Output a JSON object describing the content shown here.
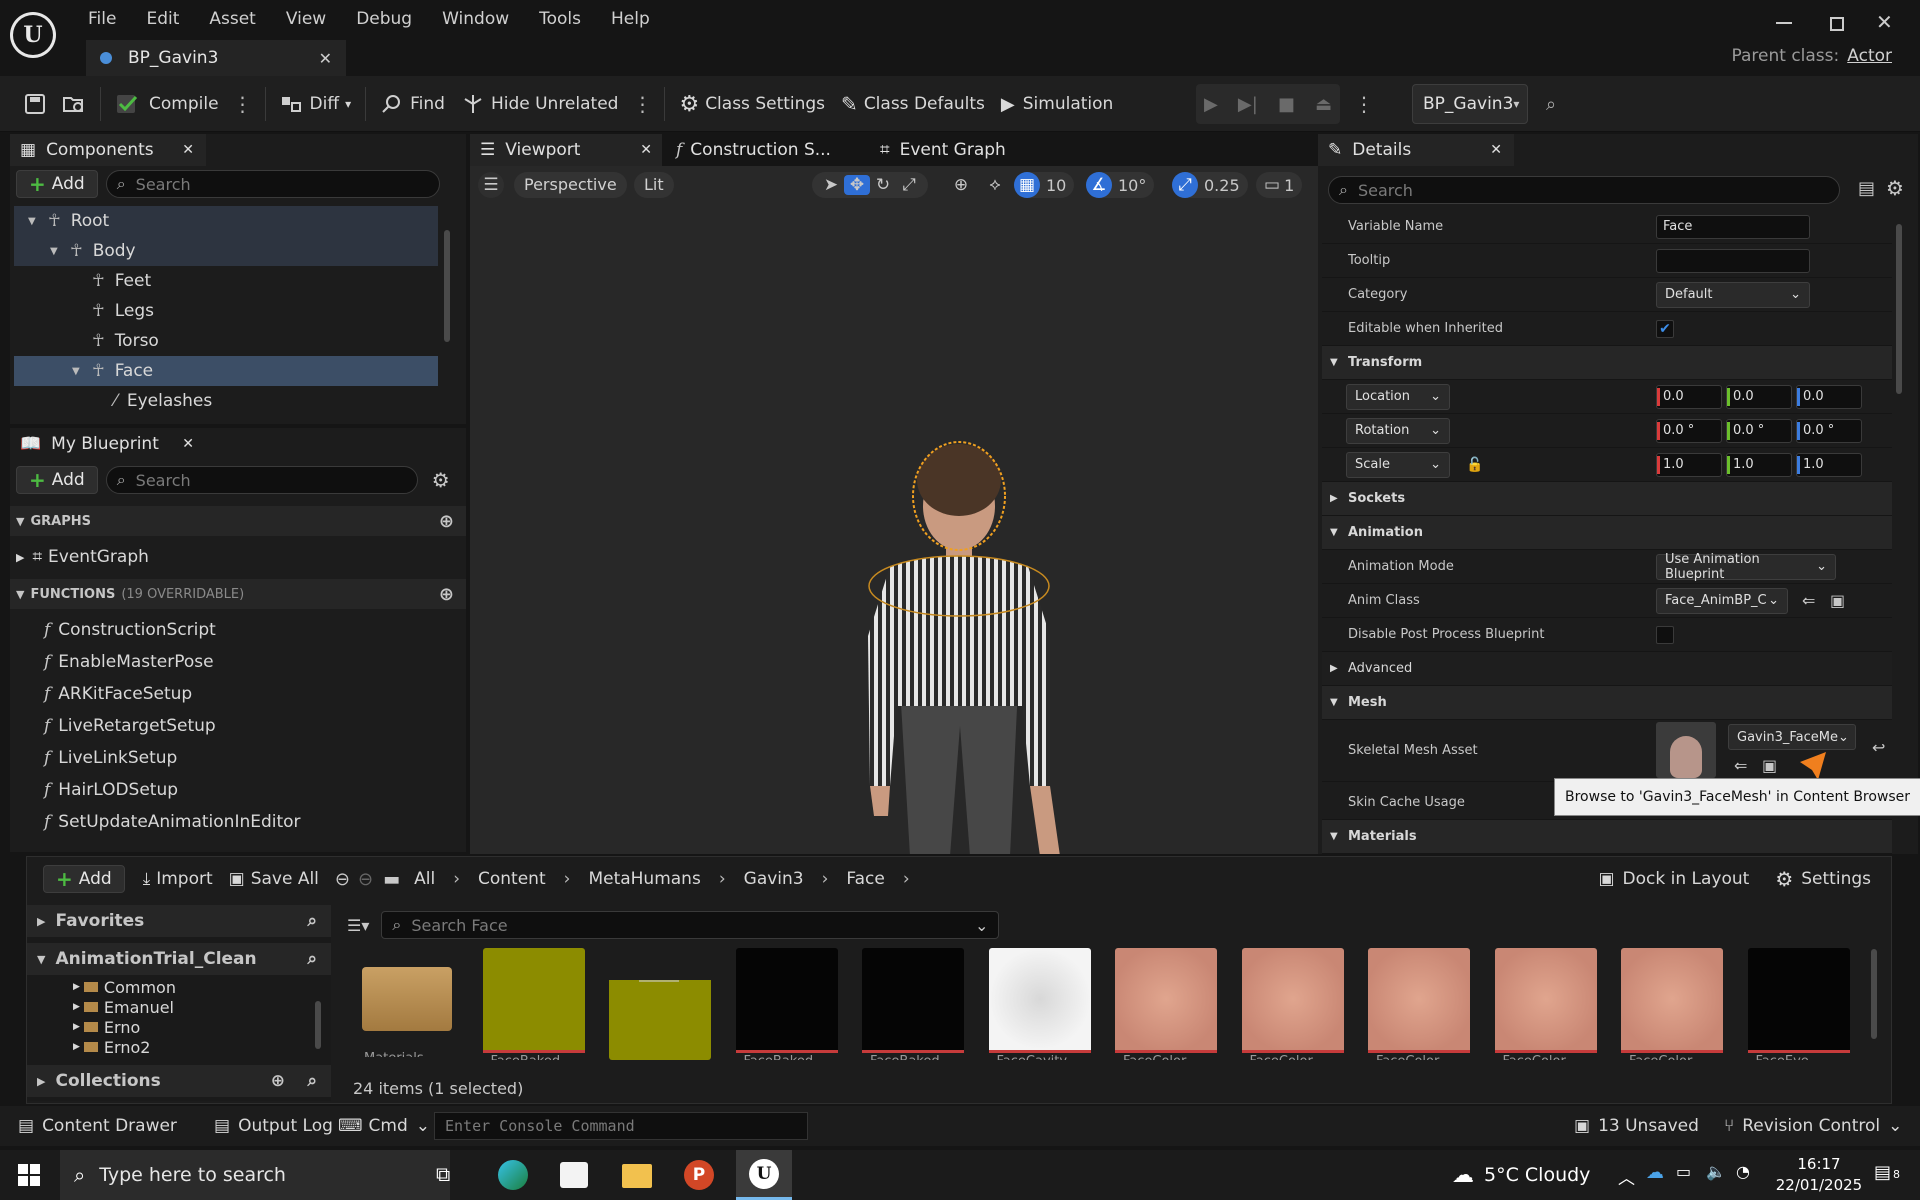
{
  "menu": [
    "File",
    "Edit",
    "Asset",
    "View",
    "Debug",
    "Window",
    "Tools",
    "Help"
  ],
  "doc_tab": {
    "title": "BP_Gavin3"
  },
  "parent_class": {
    "label": "Parent class:",
    "value": "Actor"
  },
  "toolbar": {
    "compile": "Compile",
    "diff": "Diff",
    "find": "Find",
    "hide_unrelated": "Hide Unrelated",
    "class_settings": "Class Settings",
    "class_defaults": "Class Defaults",
    "simulation": "Simulation",
    "debug_object": "BP_Gavin3"
  },
  "components": {
    "tab": "Components",
    "add": "Add",
    "search_placeholder": "Search",
    "items": [
      {
        "label": "Root",
        "indent": 0
      },
      {
        "label": "Body",
        "indent": 1
      },
      {
        "label": "Feet",
        "indent": 2
      },
      {
        "label": "Legs",
        "indent": 2
      },
      {
        "label": "Torso",
        "indent": 2
      },
      {
        "label": "Face",
        "indent": 2,
        "selected": true
      },
      {
        "label": "Eyelashes",
        "indent": 3
      }
    ]
  },
  "my_blueprint": {
    "tab": "My Blueprint",
    "add": "Add",
    "search_placeholder": "Search",
    "graphs_header": "GRAPHS",
    "graphs": [
      "EventGraph"
    ],
    "functions_header": "FUNCTIONS",
    "functions_count": "(19 OVERRIDABLE)",
    "functions": [
      "ConstructionScript",
      "EnableMasterPose",
      "ARKitFaceSetup",
      "LiveRetargetSetup",
      "LiveLinkSetup",
      "HairLODSetup",
      "SetUpdateAnimationInEditor"
    ]
  },
  "center_tabs": {
    "viewport": "Viewport",
    "construction": "Construction S...",
    "event_graph": "Event Graph"
  },
  "viewport": {
    "perspective": "Perspective",
    "lit": "Lit",
    "grid_snap": "10",
    "rot_snap": "10°",
    "scale_snap": "0.25",
    "camera_speed": "1"
  },
  "details": {
    "tab": "Details",
    "search_placeholder": "Search",
    "variable_name_label": "Variable Name",
    "variable_name_value": "Face",
    "tooltip_label": "Tooltip",
    "category_label": "Category",
    "category_value": "Default",
    "editable_label": "Editable when Inherited",
    "transform_header": "Transform",
    "location_label": "Location",
    "location": [
      "0.0",
      "0.0",
      "0.0"
    ],
    "rotation_label": "Rotation",
    "rotation": [
      "0.0 °",
      "0.0 °",
      "0.0 °"
    ],
    "scale_label": "Scale",
    "scale": [
      "1.0",
      "1.0",
      "1.0"
    ],
    "sockets_header": "Sockets",
    "animation_header": "Animation",
    "anim_mode_label": "Animation Mode",
    "anim_mode_value": "Use Animation Blueprint",
    "anim_class_label": "Anim Class",
    "anim_class_value": "Face_AnimBP_C",
    "disable_pp_label": "Disable Post Process Blueprint",
    "advanced_header": "Advanced",
    "mesh_header": "Mesh",
    "skel_mesh_label": "Skeletal Mesh Asset",
    "skel_mesh_value": "Gavin3_FaceMe",
    "skin_cache_label": "Skin Cache Usage",
    "materials_header": "Materials",
    "tooltip_popup": "Browse to 'Gavin3_FaceMesh' in Content Browser"
  },
  "content_drawer": {
    "add": "Add",
    "import": "Import",
    "save_all": "Save All",
    "breadcrumb": [
      "All",
      "Content",
      "MetaHumans",
      "Gavin3",
      "Face"
    ],
    "dock": "Dock in Layout",
    "settings": "Settings",
    "favorites": "Favorites",
    "project": "AnimationTrial_Clean",
    "folders": [
      "Common",
      "Emanuel",
      "Erno",
      "Erno2"
    ],
    "collections": "Collections",
    "search_placeholder": "Search Face",
    "status": "24 items (1 selected)",
    "assets": [
      {
        "label": "Materials",
        "kind": "folder"
      },
      {
        "label": "FaceBaked",
        "kind": "olive"
      },
      {
        "label": "FaceBaked",
        "kind": "olive-brows"
      },
      {
        "label": "FaceBaked",
        "kind": "black"
      },
      {
        "label": "FaceBaked",
        "kind": "black"
      },
      {
        "label": "FaceCavity",
        "kind": "white"
      },
      {
        "label": "FaceColor",
        "kind": "skin"
      },
      {
        "label": "FaceColor",
        "kind": "skin"
      },
      {
        "label": "FaceColor",
        "kind": "skin"
      },
      {
        "label": "FaceColor",
        "kind": "skin"
      },
      {
        "label": "FaceColor",
        "kind": "skin"
      },
      {
        "label": "FaceEye",
        "kind": "black"
      }
    ]
  },
  "statusbar": {
    "content_drawer": "Content Drawer",
    "output_log": "Output Log",
    "cmd": "Cmd",
    "console_placeholder": "Enter Console Command",
    "unsaved": "13 Unsaved",
    "revision": "Revision Control"
  },
  "taskbar": {
    "search_placeholder": "Type here to search",
    "weather": "5°C  Cloudy",
    "time": "16:17",
    "date": "22/01/2025",
    "notif_count": "8"
  },
  "colors": {
    "accent": "#2f6fd6",
    "select": "#3c4e66",
    "play_green": "#4dbb42",
    "orange": "#f07f1e"
  }
}
